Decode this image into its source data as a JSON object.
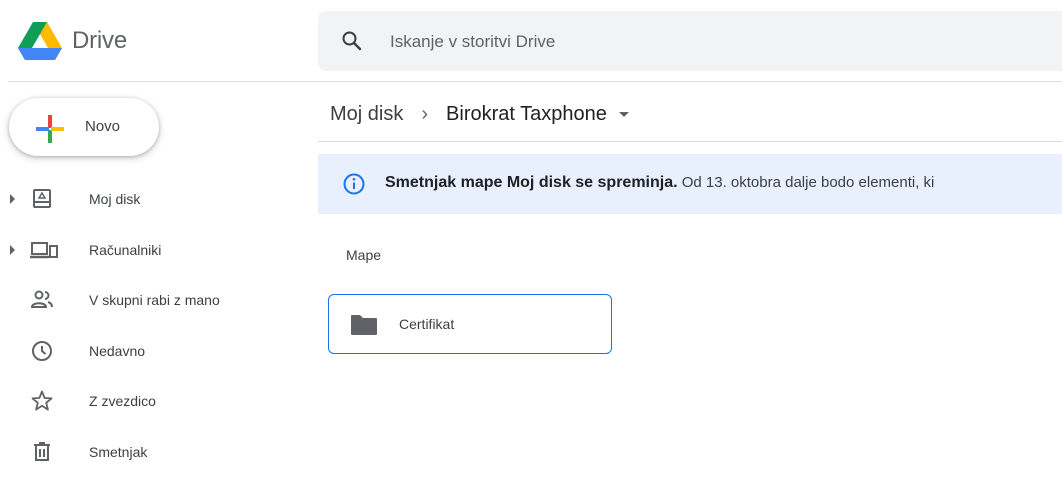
{
  "header": {
    "app_name": "Drive",
    "search_placeholder": "Iskanje v storitvi Drive"
  },
  "new_button": {
    "label": "Novo"
  },
  "sidebar": {
    "items": [
      {
        "label": "Moj disk",
        "icon": "my-drive-icon",
        "expandable": true
      },
      {
        "label": "Računalniki",
        "icon": "computers-icon",
        "expandable": true
      },
      {
        "label": "V skupni rabi z mano",
        "icon": "shared-icon",
        "expandable": false
      },
      {
        "label": "Nedavno",
        "icon": "clock-icon",
        "expandable": false
      },
      {
        "label": "Z zvezdico",
        "icon": "star-icon",
        "expandable": false
      },
      {
        "label": "Smetnjak",
        "icon": "trash-icon",
        "expandable": false
      }
    ]
  },
  "breadcrumb": {
    "root": "Moj disk",
    "separator": "›",
    "current": "Birokrat Taxphone"
  },
  "banner": {
    "bold": "Smetnjak mape Moj disk se spreminja.",
    "rest": " Od 13. oktobra dalje bodo elementi, ki"
  },
  "section": {
    "folders_label": "Mape"
  },
  "folders": [
    {
      "name": "Certifikat"
    }
  ],
  "colors": {
    "accent": "#1a73e8",
    "banner_bg": "#e8f0fe",
    "search_bg": "#f1f3f4",
    "icon_gray": "#5f6368"
  }
}
